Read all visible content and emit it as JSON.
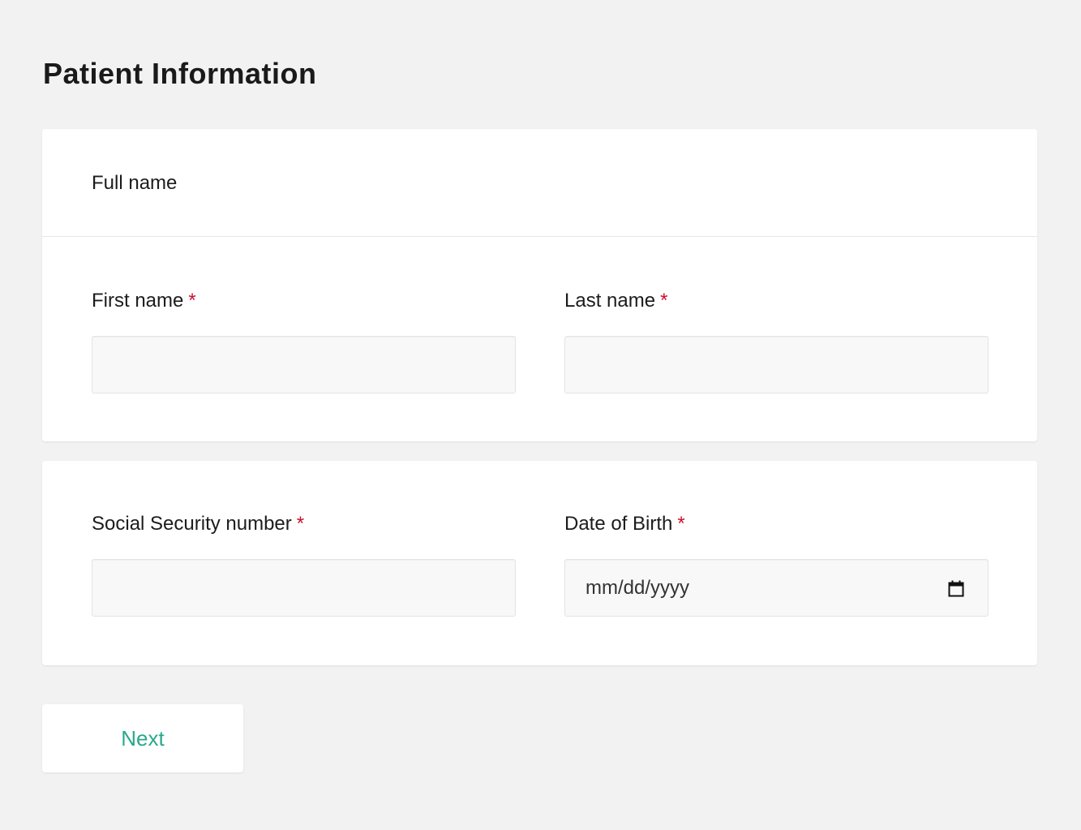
{
  "page": {
    "title": "Patient Information"
  },
  "full_name_section": {
    "title": "Full name",
    "first_name": {
      "label": "First name",
      "required_mark": "*",
      "value": ""
    },
    "last_name": {
      "label": "Last name",
      "required_mark": "*",
      "value": ""
    }
  },
  "identity_section": {
    "ssn": {
      "label": "Social Security number",
      "required_mark": "*",
      "value": ""
    },
    "dob": {
      "label": "Date of Birth",
      "required_mark": "*",
      "placeholder": "mm/dd/yyyy",
      "icon": "calendar-icon"
    }
  },
  "actions": {
    "next_label": "Next"
  },
  "colors": {
    "background": "#f2f2f2",
    "card": "#ffffff",
    "required": "#c8102e",
    "accent": "#2aa88a"
  }
}
